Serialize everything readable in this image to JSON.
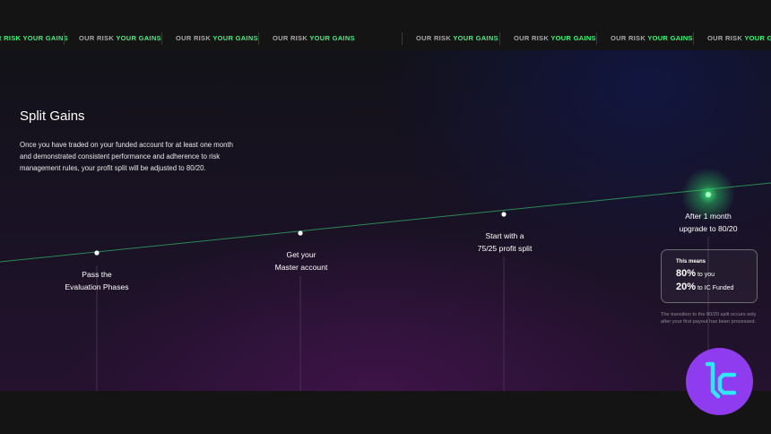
{
  "ticker": {
    "items": [
      {
        "white": "",
        "green": "R RISK YOUR GAINS"
      },
      {
        "white": "OUR RISK ",
        "green": "YOUR GAINS"
      },
      {
        "white": "OUR RISK ",
        "green": "YOUR GAINS"
      },
      {
        "white": "OUR RISK ",
        "green": "YOUR GAINS"
      },
      {
        "white": "OUR RISK ",
        "green": "YOUR GAINS"
      },
      {
        "white": "OUR RISK ",
        "green": "YOUR GAINS"
      },
      {
        "white": "OUR RISK ",
        "green": "YOUR GAINS"
      },
      {
        "white": "OUR RISK ",
        "green": "YOUR GAINS"
      }
    ]
  },
  "section": {
    "title": "Split Gains",
    "description": "Once you have traded on your funded account for at least one month and demonstrated consistent performance and adherence to risk management rules, your profit split will be adjusted to 80/20."
  },
  "steps": [
    {
      "line1": "Pass the",
      "line2": "Evaluation Phases"
    },
    {
      "line1": "Get your",
      "line2": "Master account"
    },
    {
      "line1": "Start with a",
      "line2": "75/25 profit split"
    },
    {
      "line1": "After 1 month",
      "line2": "upgrade to 80/20"
    }
  ],
  "info": {
    "heading": "This means",
    "row1_value": "80%",
    "row1_text": " to you",
    "row2_value": "20%",
    "row2_text": " to IC Funded"
  },
  "note": "The transition to the 80/20 split occurs only after your first payout has been processed.",
  "colors": {
    "accent_green": "#3cf07a",
    "logo_purple": "#8f3bf0",
    "logo_cyan": "#2ee8f5"
  },
  "icons": {
    "logo": "ic-funded-logo-icon"
  }
}
